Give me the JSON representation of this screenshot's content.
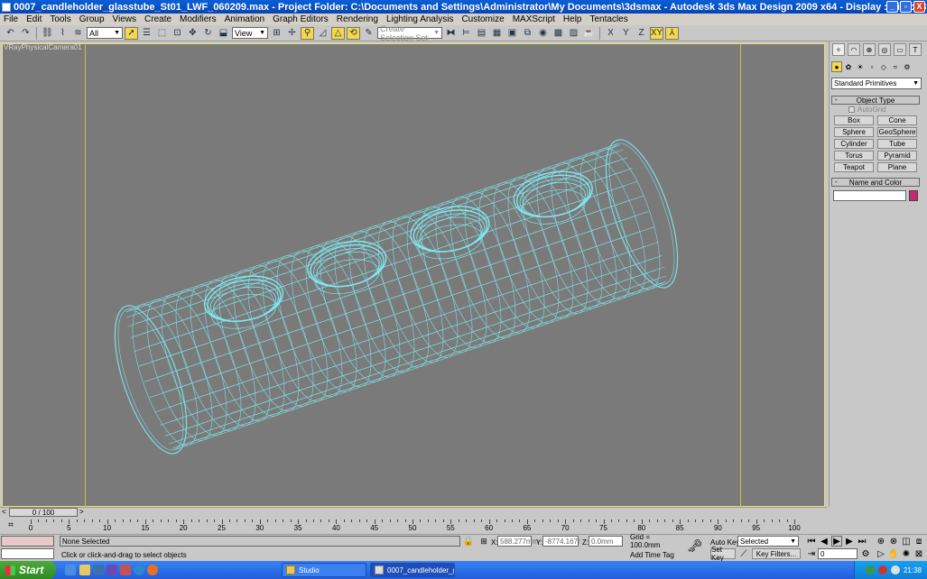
{
  "window": {
    "title": "0007_candleholder_glasstube_St01_LWF_060209.max      - Project Folder: C:\\Documents and Settings\\Administrator\\My Documents\\3dsmax      - Autodesk 3ds Max Design 2009 x64      - Display : Direct 3D",
    "controls": [
      "_",
      "▫",
      "X"
    ]
  },
  "menu": [
    "File",
    "Edit",
    "Tools",
    "Group",
    "Views",
    "Create",
    "Modifiers",
    "Animation",
    "Graph Editors",
    "Rendering",
    "Lighting Analysis",
    "Customize",
    "MAXScript",
    "Help",
    "Tentacles"
  ],
  "toolbar": {
    "selection_filter": "All",
    "ref_coord": "View",
    "named_selection_placeholder": "Create Selection Set",
    "axis_x": "X",
    "axis_y": "Y",
    "axis_z": "Z",
    "axis_xy": "XY"
  },
  "viewport": {
    "label": "VRayPhysicalCamera01",
    "wire_color": "#7ee8f0",
    "background": "#7a7a7a"
  },
  "command_panel": {
    "category": "Standard Primitives",
    "object_type_title": "Object Type",
    "autogrid": "AutoGrid",
    "primitives": [
      "Box",
      "Cone",
      "Sphere",
      "GeoSphere",
      "Cylinder",
      "Tube",
      "Torus",
      "Pyramid",
      "Teapot",
      "Plane"
    ],
    "name_color_title": "Name and Color",
    "object_color": "#c8286e"
  },
  "timeline": {
    "frame_display": "0 / 100",
    "ticks": [
      "0",
      "5",
      "10",
      "15",
      "20",
      "25",
      "30",
      "35",
      "40",
      "45",
      "50",
      "55",
      "60",
      "65",
      "70",
      "75",
      "80",
      "85",
      "90",
      "95",
      "100"
    ]
  },
  "status": {
    "selection": "None Selected",
    "prompt": "Click or click-and-drag to select objects",
    "x_label": "X:",
    "x_value": "588.277mm",
    "y_label": "Y:",
    "y_value": "-8774.167r",
    "z_label": "Z:",
    "z_value": "0.0mm",
    "grid": "Grid = 100.0mm",
    "add_time_tag": "Add Time Tag",
    "auto_key": "Auto Key",
    "selected_option": "Selected",
    "set_key": "Set Key",
    "key_filters": "Key Filters...",
    "current_frame": "0"
  },
  "taskbar": {
    "start": "Start",
    "tasks": [
      "Studio",
      "0007_candleholder_g..."
    ],
    "clock": "21:38"
  }
}
